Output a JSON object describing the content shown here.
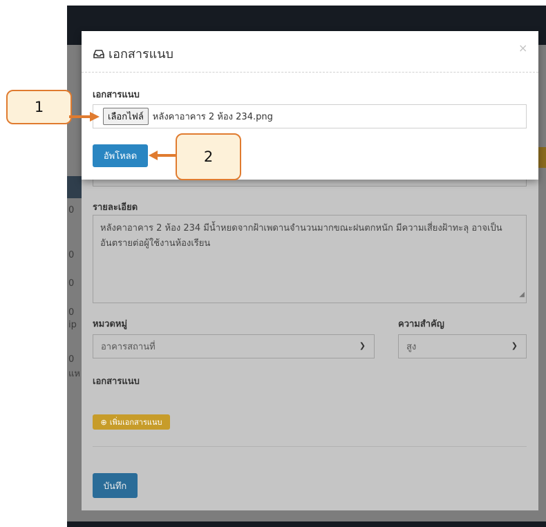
{
  "background": {
    "fragments": [
      "0",
      "0",
      "0",
      "0",
      "0",
      "ip",
      "0",
      "แห"
    ]
  },
  "modal": {
    "title": "เอกสารแนบ",
    "title_icon": "inbox-icon",
    "close_label": "×",
    "attachment_label": "เอกสารแนบ",
    "choose_file_label": "เลือกไฟล์",
    "selected_file": "หลังคาอาคาร 2 ห้อง 234.png",
    "upload_label": "อัพโหลด"
  },
  "callouts": {
    "one": "1",
    "two": "2",
    "accent_color": "#e07b2f"
  },
  "form": {
    "detail_label": "รายละเอียด",
    "detail_value": "หลังคาอาคาร 2 ห้อง 234 มีน้ำหยดจากฝ้าเพดานจำนวนมากขณะฝนตกหนัก มีความเสี่ยงฝ้าทะลุ อาจเป็นอันตรายต่อผู้ใช้งานห้องเรียน",
    "category_label": "หมวดหมู่",
    "category_value": "อาคารสถานที่",
    "priority_label": "ความสำคัญ",
    "priority_value": "สูง",
    "attachments_label": "เอกสารแนบ",
    "add_attachment_label": "เพิ่มเอกสารแนบ",
    "save_label": "บันทึก"
  }
}
